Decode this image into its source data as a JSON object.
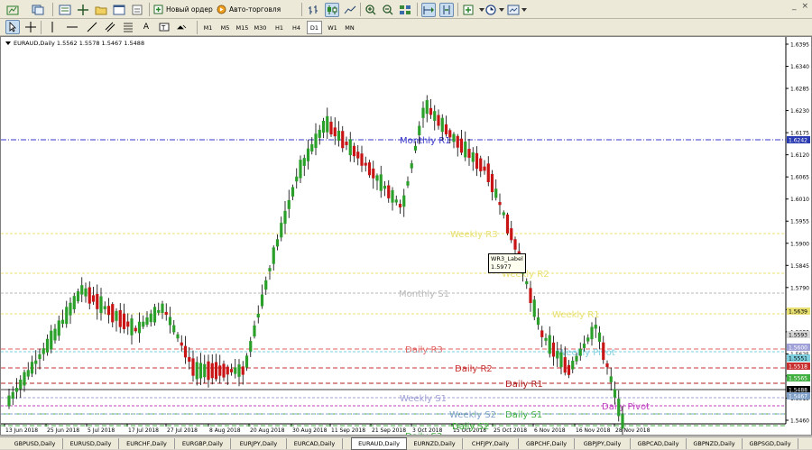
{
  "toolbar": {
    "new_order_label": "Новый ордер",
    "auto_trading_label": "Авто-торговля",
    "timeframes": [
      "M1",
      "M5",
      "M15",
      "M30",
      "H1",
      "H4",
      "D1",
      "W1",
      "MN"
    ],
    "selected_timeframe": "D1"
  },
  "window_controls": {
    "restore": "_",
    "close": "×"
  },
  "chart": {
    "header": "EURAUD,Daily  1.5562 1.5578 1.5467 1.5488",
    "price_labels": [
      "1.6395",
      "1.6340",
      "1.6285",
      "1.6230",
      "1.6175",
      "1.6120",
      "1.6065",
      "1.6010",
      "1.5955",
      "1.5900",
      "1.5845",
      "1.5790",
      "1.5735",
      "1.5680",
      "1.5625",
      "1.5570",
      "1.5515",
      "1.5460"
    ],
    "marked_prices": [
      "1.6242",
      "1.5488",
      "1.5467",
      "1.5639",
      "1.5593",
      "1.5551",
      "1.5518",
      "1.5600",
      "1.5565"
    ],
    "date_labels": [
      "13 Jun 2018",
      "25 Jun 2018",
      "5 Jul 2018",
      "17 Jul 2018",
      "27 Jul 2018",
      "8 Aug 2018",
      "20 Aug 2018",
      "30 Aug 2018",
      "11 Sep 2018",
      "21 Sep 2018",
      "3 Oct 2018",
      "15 Oct 2018",
      "25 Oct 2018",
      "6 Nov 2018",
      "16 Nov 2018",
      "28 Nov 2018"
    ],
    "levels": [
      {
        "label": "Monthly R1",
        "color": "#3a3ac8"
      },
      {
        "label": "Weekly R3",
        "color": "#e8e070"
      },
      {
        "label": "Weekly R2",
        "color": "#e8e070"
      },
      {
        "label": "Monthly S1",
        "color": "#b8b8b8"
      },
      {
        "label": "Weekly R1",
        "color": "#e8e070"
      },
      {
        "label": "Daily R3",
        "color": "#e06060"
      },
      {
        "label": "Weekly Pivot",
        "color": "#7ed0e0"
      },
      {
        "label": "Daily R2",
        "color": "#c83030"
      },
      {
        "label": "Daily R1",
        "color": "#b02020"
      },
      {
        "label": "Weekly S1",
        "color": "#a0a0d8"
      },
      {
        "label": "Daily Pivot",
        "color": "#c040c0"
      },
      {
        "label": "Daily S1",
        "color": "#40b040"
      },
      {
        "label": "Weekly S2",
        "color": "#80a0c8"
      },
      {
        "label": "Daily S2",
        "color": "#40b040"
      },
      {
        "label": "Daily S3",
        "color": "#40b040"
      }
    ],
    "tooltip_label": "WR3_Label",
    "tooltip_value": "1.5977"
  },
  "tabs": [
    "GBPUSD,Daily",
    "EURUSD,Daily",
    "EURCHF,Daily",
    "EURGBP,Daily",
    "EURJPY,Daily",
    "EURCAD,Daily",
    "EURAUD,Daily",
    "EURNZD,Daily",
    "CHFJPY,Daily",
    "GBPCHF,Daily",
    "GBPJPY,Daily",
    "GBPCAD,Daily",
    "GBPNZD,Daily",
    "GBPSGD,Daily"
  ],
  "active_tab": "EURAUD,Daily"
}
